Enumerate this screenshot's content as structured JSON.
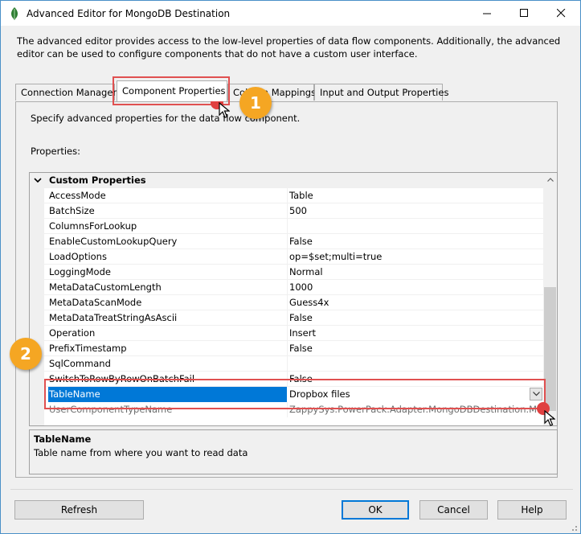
{
  "window": {
    "title": "Advanced Editor for MongoDB Destination"
  },
  "description": "The advanced editor provides access to the low-level properties of data flow components. Additionally, the advanced editor can be used to configure components that do not have a custom user interface.",
  "tabs": [
    {
      "label": "Connection Managers"
    },
    {
      "label": "Component Properties"
    },
    {
      "label": "Column Mappings"
    },
    {
      "label": "Input and Output Properties"
    }
  ],
  "hint": "Specify advanced properties for the data flow component.",
  "properties_label": "Properties:",
  "grid": {
    "category": "Custom Properties",
    "rows": [
      {
        "name": "AccessMode",
        "value": "Table"
      },
      {
        "name": "BatchSize",
        "value": "500"
      },
      {
        "name": "ColumnsForLookup",
        "value": ""
      },
      {
        "name": "EnableCustomLookupQuery",
        "value": "False"
      },
      {
        "name": "LoadOptions",
        "value": "op=$set;multi=true"
      },
      {
        "name": "LoggingMode",
        "value": "Normal"
      },
      {
        "name": "MetaDataCustomLength",
        "value": "1000"
      },
      {
        "name": "MetaDataScanMode",
        "value": "Guess4x"
      },
      {
        "name": "MetaDataTreatStringAsAscii",
        "value": "False"
      },
      {
        "name": "Operation",
        "value": "Insert"
      },
      {
        "name": "PrefixTimestamp",
        "value": "False"
      },
      {
        "name": "SqlCommand",
        "value": ""
      },
      {
        "name": "SwitchToRowByRowOnBatchFail",
        "value": "False"
      },
      {
        "name": "TableName",
        "value": "Dropbox files"
      },
      {
        "name": "UserComponentTypeName",
        "value": "ZappySys.PowerPack.Adapter.MongoDBDestination.Mongo"
      }
    ]
  },
  "help": {
    "title": "TableName",
    "text": "Table name from where you want to read data"
  },
  "buttons": {
    "refresh": "Refresh",
    "ok": "OK",
    "cancel": "Cancel",
    "help": "Help"
  },
  "badges": {
    "first": "1",
    "second": "2"
  },
  "colors": {
    "accent": "#0078d7",
    "highlight": "#e05050",
    "badge": "#f5a623"
  }
}
